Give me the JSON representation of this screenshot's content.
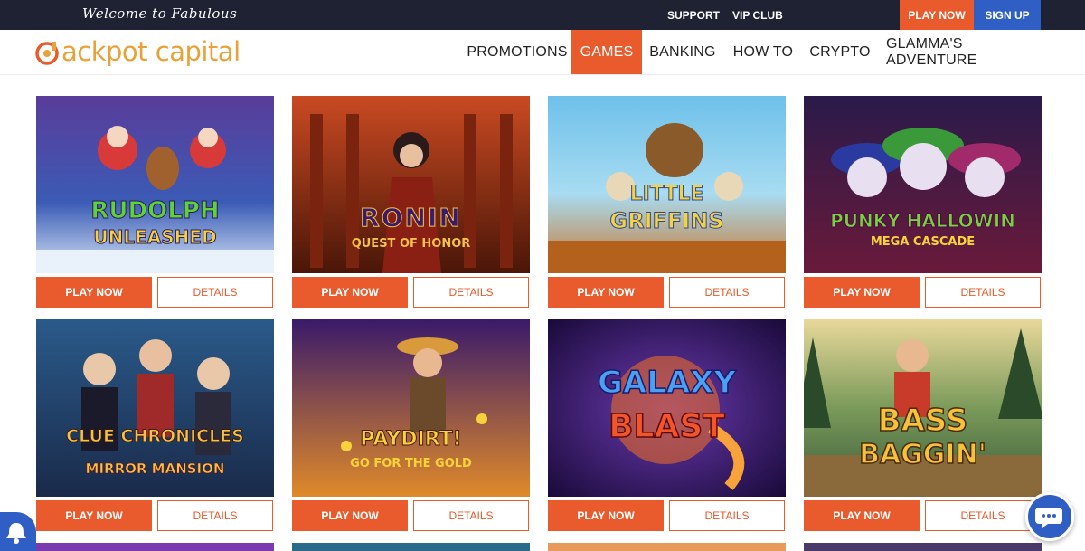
{
  "topbar": {
    "welcome": "Welcome to Fabulous",
    "links": [
      "SUPPORT",
      "VIP CLUB"
    ],
    "play_now": "PLAY NOW",
    "sign_up": "SIGN UP"
  },
  "logo": {
    "text": "ackpot capital"
  },
  "nav": {
    "items": [
      "PROMOTIONS",
      "GAMES",
      "BANKING",
      "HOW TO",
      "CRYPTO",
      "GLAMMA'S ADVENTURE"
    ],
    "active": "GAMES"
  },
  "games": [
    {
      "title_line1": "RUDOLPH",
      "title_line2": "UNLEASHED"
    },
    {
      "title_line1": "RONIN",
      "title_line2": "QUEST OF HONOR"
    },
    {
      "title_line1": "LITTLE",
      "title_line2": "GRIFFINS"
    },
    {
      "title_line1": "PUNKY HALLOWIN",
      "title_line2": "MEGA CASCADE"
    },
    {
      "title_line1": "CLUE CHRONICLES",
      "title_line2": "MIRROR MANSION"
    },
    {
      "title_line1": "PAYDIRT!",
      "title_line2": "GO FOR THE GOLD"
    },
    {
      "title_line1": "GALAXY",
      "title_line2": "BLAST"
    },
    {
      "title_line1": "BASS",
      "title_line2": "BAGGIN'"
    }
  ],
  "buttons": {
    "play_now": "PLAY NOW",
    "details": "DETAILS"
  },
  "colors": {
    "accent": "#e95a2c",
    "blue": "#2f5fc4",
    "topbar": "#1e2232"
  }
}
